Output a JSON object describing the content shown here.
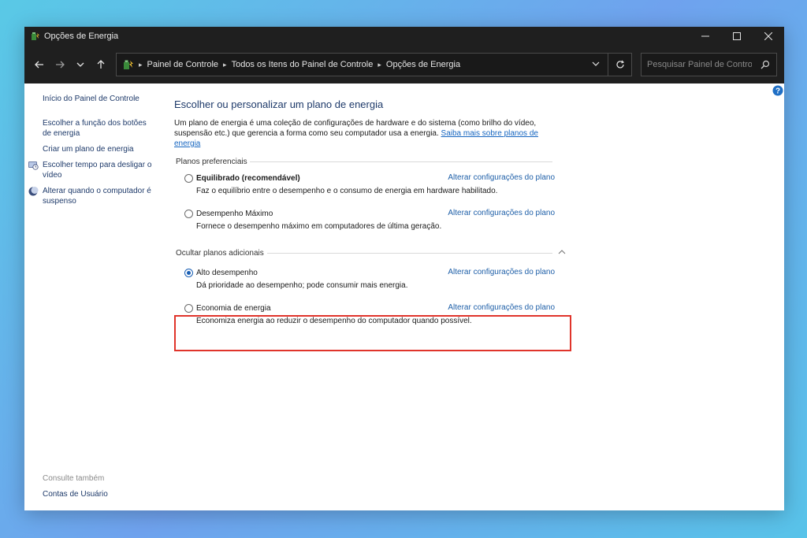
{
  "window": {
    "title": "Opções de Energia",
    "controls": {
      "minimize": "—",
      "maximize": "☐",
      "close": "✕"
    }
  },
  "address": {
    "breadcrumbs": [
      "Painel de Controle",
      "Todos os Itens do Painel de Controle",
      "Opções de Energia"
    ]
  },
  "search": {
    "placeholder": "Pesquisar Painel de Controle"
  },
  "sidebar": {
    "home": "Início do Painel de Controle",
    "links": [
      "Escolher a função dos botões de energia",
      "Criar um plano de energia",
      "Escolher tempo para desligar o vídeo",
      "Alterar quando o computador é suspenso"
    ],
    "see_also_label": "Consulte também",
    "see_also_links": [
      "Contas de Usuário"
    ]
  },
  "main": {
    "title": "Escolher ou personalizar um plano de energia",
    "description": "Um plano de energia é uma coleção de configurações de hardware e do sistema (como brilho do vídeo, suspensão etc.) que gerencia a forma como seu computador usa a energia.",
    "learn_more": "Saiba mais sobre planos de energia",
    "preferred_label": "Planos preferenciais",
    "additional_label": "Ocultar planos adicionais",
    "change_link": "Alterar configurações do plano",
    "plans": [
      {
        "name": "Equilibrado (recomendável)",
        "description": "Faz o equilíbrio entre o desempenho e o consumo de energia em hardware habilitado.",
        "selected": false
      },
      {
        "name": "Desempenho Máximo",
        "description": "Fornece o desempenho máximo em computadores de última geração.",
        "selected": false
      },
      {
        "name": "Alto desempenho",
        "description": "Dá prioridade ao desempenho; pode consumir mais energia.",
        "selected": true
      },
      {
        "name": "Economia de energia",
        "description": "Economiza energia ao reduzir o desempenho do computador quando possível.",
        "selected": false
      }
    ]
  },
  "colors": {
    "accent": "#1a5fb4",
    "link": "#1e5fa8",
    "highlight": "#e0342b",
    "titlebar": "#1f1f1f"
  }
}
